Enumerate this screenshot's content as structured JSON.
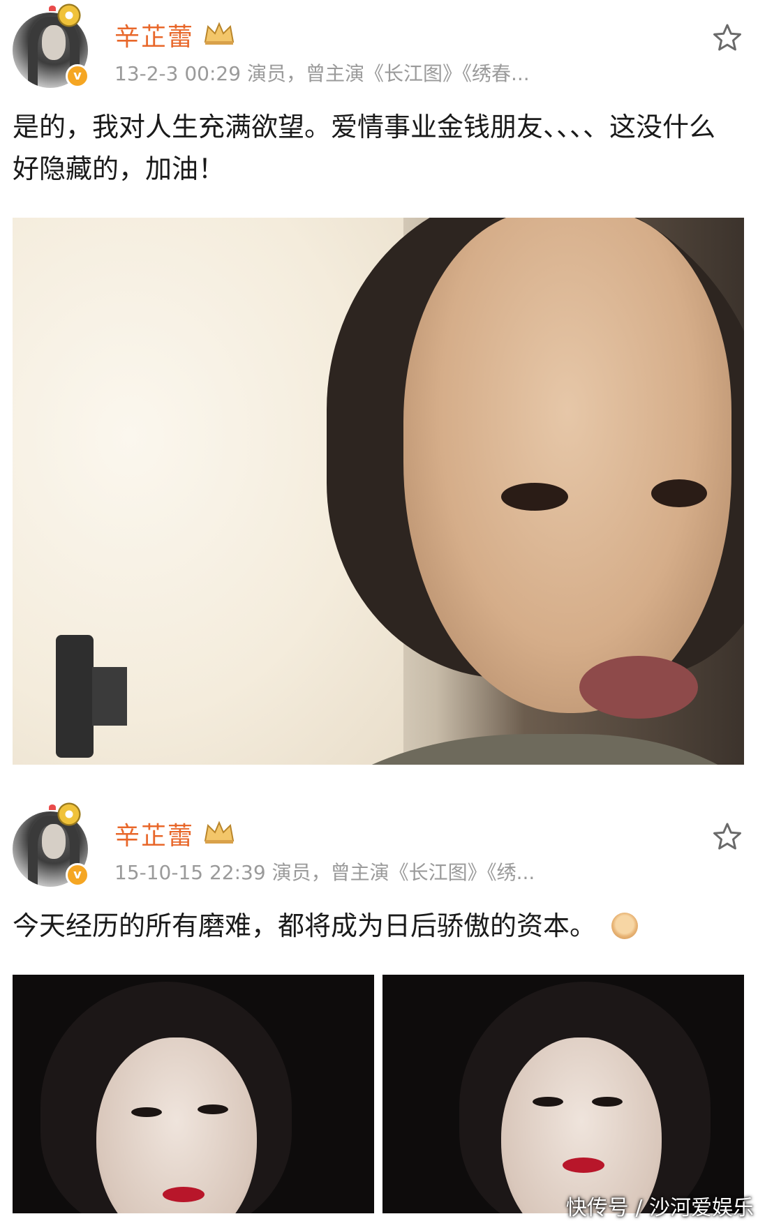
{
  "posts": [
    {
      "username": "辛芷蕾",
      "meta": "13-2-3 00:29  演员，曾主演《长江图》《绣春...",
      "text": "是的，我对人生充满欲望。爱情事业金钱朋友、、、、这没什么好隐藏的，加油！",
      "icons": [
        "avatar",
        "verified-badge-icon",
        "crown-icon",
        "star-icon"
      ]
    },
    {
      "username": "辛芷蕾",
      "meta": "15-10-15 22:39  演员，曾主演《长江图》《绣...",
      "text": "今天经历的所有磨难，都将成为日后骄傲的资本。",
      "icons": [
        "avatar",
        "verified-badge-icon",
        "crown-icon",
        "star-icon",
        "fist-emoji-icon"
      ]
    }
  ],
  "watermark": "快传号 / 沙河爱娱乐",
  "colors": {
    "username": "#e8672a",
    "meta": "#9a9a9a",
    "verified_badge": "#f5a623"
  }
}
